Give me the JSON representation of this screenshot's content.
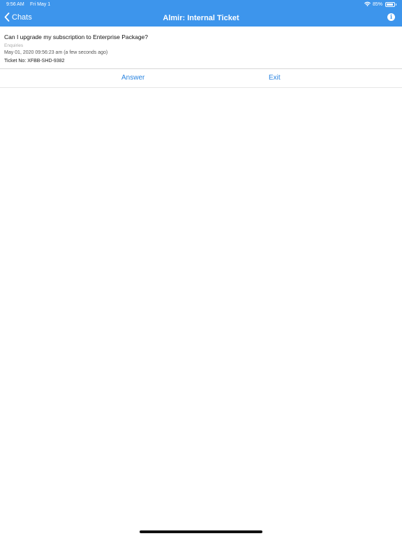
{
  "status_bar": {
    "time": "9:56 AM",
    "date": "Fri May 1",
    "battery": "85%",
    "battery_level": 0.85
  },
  "navbar": {
    "back_label": "Chats",
    "title": "Almir: Internal Ticket",
    "info_glyph": "i"
  },
  "ticket": {
    "question": "Can I upgrade my subscription to Enterprise Package?",
    "category": "Enquiries",
    "timestamp": "May 01, 2020 09:56:23 am (a few seconds ago)",
    "ticket_no": "Ticket No: XFBB-SHD-9382"
  },
  "actions": {
    "answer_label": "Answer",
    "exit_label": "Exit"
  },
  "colors": {
    "nav_background": "#3d95ec",
    "action_text": "#2a84e0"
  },
  "icons": {
    "back": "chevron-left-icon",
    "info": "info-icon",
    "wifi": "wifi-icon",
    "battery": "battery-icon"
  }
}
